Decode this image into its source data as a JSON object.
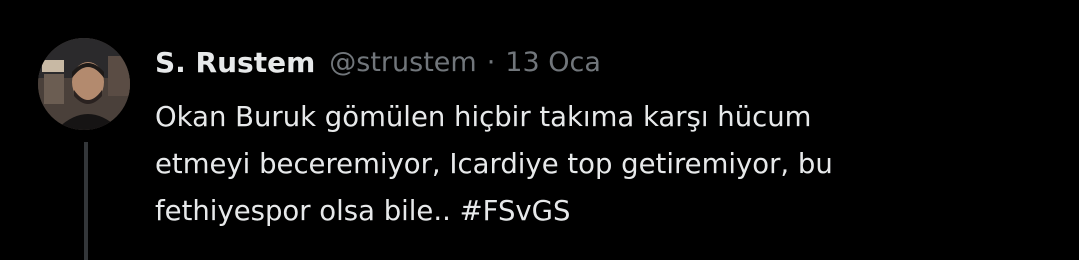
{
  "tweet": {
    "author_name": "S. Rustem",
    "handle": "@strustem",
    "separator": "·",
    "date": "13 Oca",
    "text_lines": [
      "Okan Buruk gömülen hiçbir takıma karşı hücum",
      "etmeyi beceremiyor, Icardiye top getiremiyor, bu",
      "fethiyespor olsa bile.."
    ],
    "hashtag": "#FSvGS"
  },
  "colors": {
    "background": "#000000",
    "primary_text": "#e7e9ea",
    "secondary_text": "#71767b",
    "thread_line": "#333639"
  }
}
